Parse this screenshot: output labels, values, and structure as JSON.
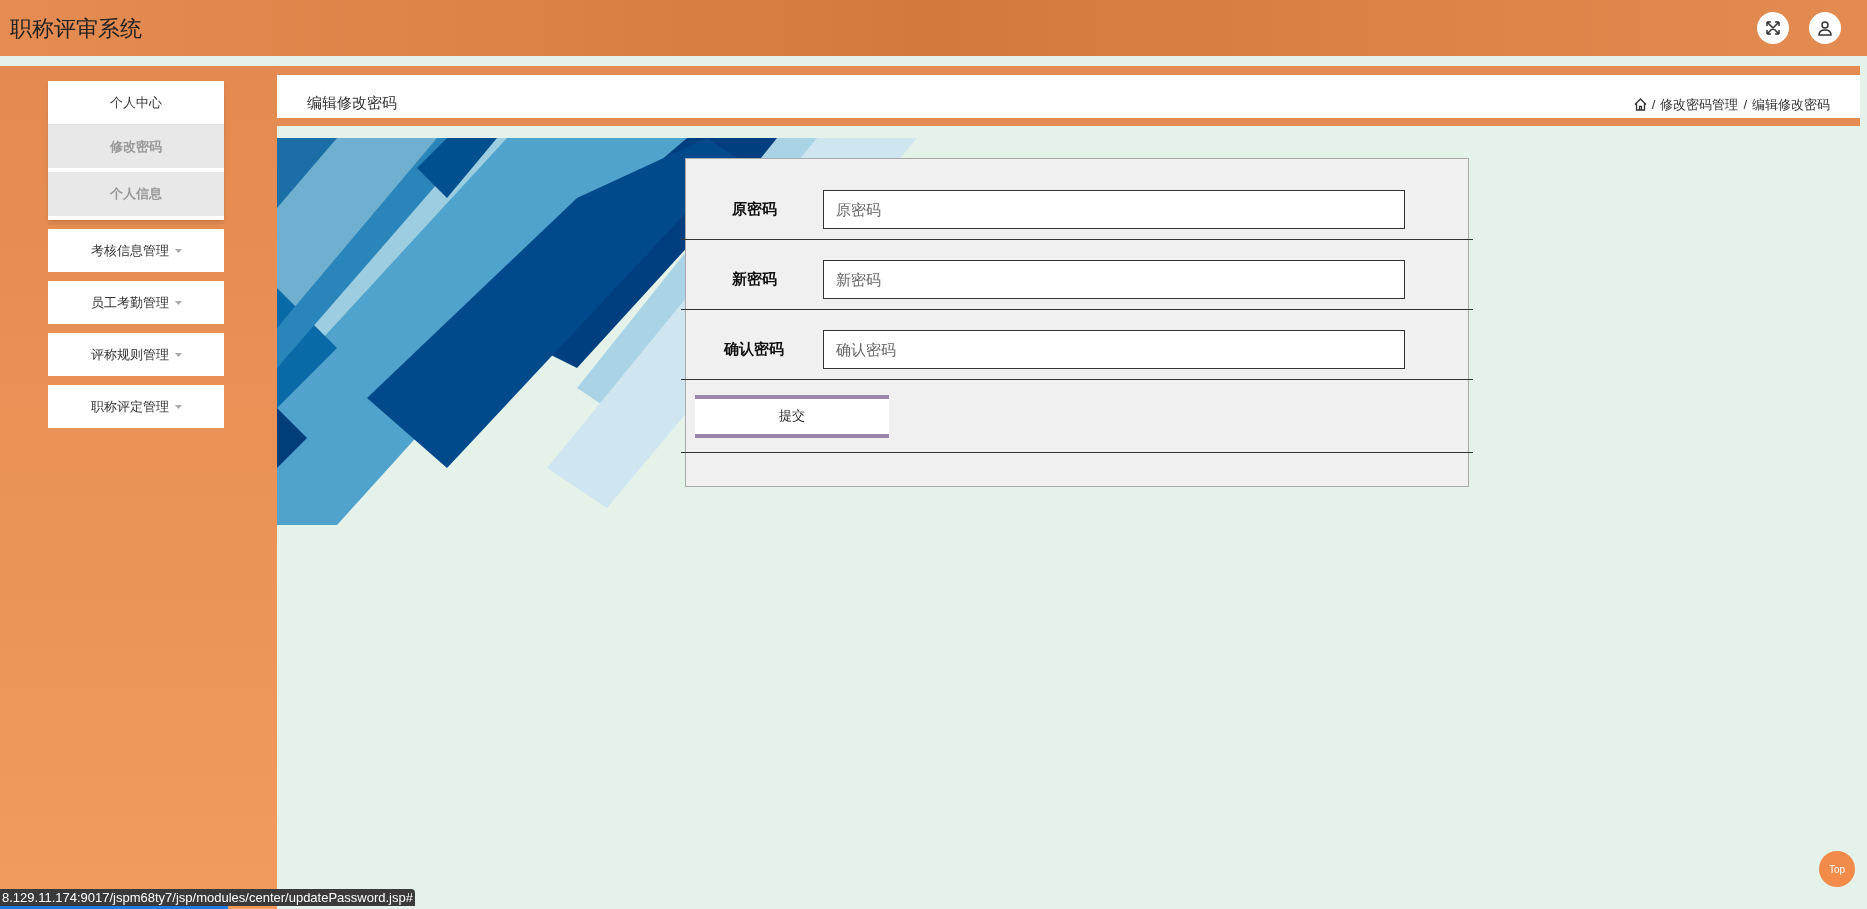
{
  "header": {
    "title": "职称评审系统"
  },
  "sidebar": {
    "items": [
      {
        "label": "个人中心",
        "expanded": true,
        "children": [
          {
            "label": "修改密码"
          },
          {
            "label": "个人信息"
          }
        ]
      },
      {
        "label": "考核信息管理",
        "expanded": false
      },
      {
        "label": "员工考勤管理",
        "expanded": false
      },
      {
        "label": "评称规则管理",
        "expanded": false
      },
      {
        "label": "职称评定管理",
        "expanded": false
      }
    ]
  },
  "page_header": {
    "title": "编辑修改密码",
    "separator": "/",
    "breadcrumb": [
      "修改密码管理",
      "编辑修改密码"
    ]
  },
  "form": {
    "fields": [
      {
        "label": "原密码",
        "placeholder": "原密码"
      },
      {
        "label": "新密码",
        "placeholder": "新密码"
      },
      {
        "label": "确认密码",
        "placeholder": "确认密码"
      }
    ],
    "submit": "提交"
  },
  "back_to_top": "Top",
  "status_url": "8.129.11.174:9017/jspm68ty7/jsp/modules/center/updatePassword.jsp#"
}
